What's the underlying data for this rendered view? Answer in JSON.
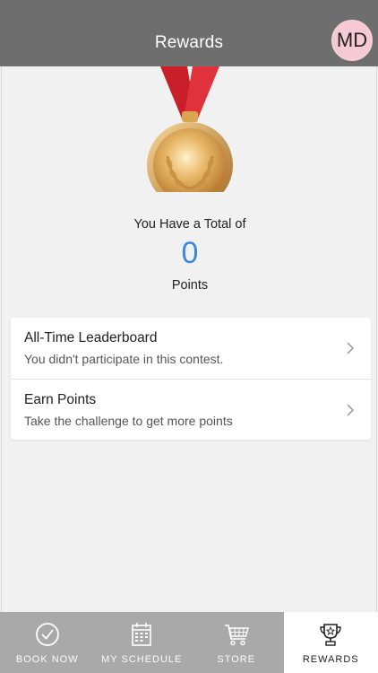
{
  "header": {
    "title": "Rewards",
    "avatar_initials": "MD"
  },
  "summary": {
    "intro": "You Have a Total of",
    "points": "0",
    "unit": "Points"
  },
  "menu": {
    "items": [
      {
        "title": "All-Time Leaderboard",
        "subtitle": "You didn't participate in this contest."
      },
      {
        "title": "Earn Points",
        "subtitle": "Take the challenge to get more points"
      }
    ]
  },
  "tabs": [
    {
      "label": "BOOK NOW",
      "icon": "check-circle-icon",
      "active": false
    },
    {
      "label": "MY SCHEDULE",
      "icon": "calendar-icon",
      "active": false
    },
    {
      "label": "STORE",
      "icon": "cart-icon",
      "active": false
    },
    {
      "label": "REWARDS",
      "icon": "trophy-icon",
      "active": true
    }
  ],
  "colors": {
    "header": "#6e6e6e",
    "points_accent": "#3d86d8",
    "avatar": "#f7c9d4",
    "tabbar": "#a9a9a9"
  }
}
